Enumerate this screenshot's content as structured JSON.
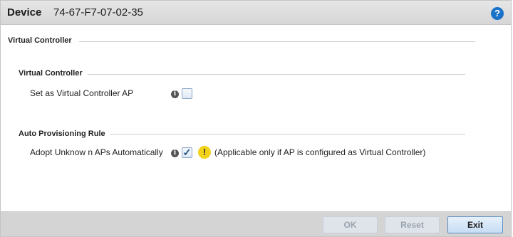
{
  "header": {
    "label": "Device",
    "value": "74-67-F7-07-02-35",
    "help_icon": "help-icon"
  },
  "sections": {
    "outer_title": "Virtual Controller",
    "virtual_controller": {
      "title": "Virtual Controller",
      "field_label": "Set as Virtual Controller AP",
      "checked": false
    },
    "auto_provisioning": {
      "title": "Auto Provisioning Rule",
      "field_label": "Adopt Unknow n APs Automatically",
      "checked": true,
      "note": "(Applicable only if AP is configured as Virtual Controller)"
    }
  },
  "footer": {
    "ok_label": "OK",
    "reset_label": "Reset",
    "exit_label": "Exit"
  },
  "colors": {
    "accent": "#1a73c9",
    "warning": "#f2d21b",
    "footer_bg": "#d4d4d4"
  }
}
